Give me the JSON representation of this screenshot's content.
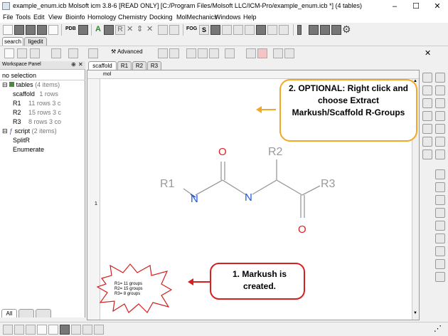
{
  "window": {
    "title": "example_enum.icb Molsoft icm 3.8-6 [READ ONLY]  [C:/Program Files/Molsoft LLC/ICM-Pro/example_enum.icb *] (4 tables)",
    "minimize": "–",
    "maximize": "☐",
    "close": "✕"
  },
  "menu": [
    "File",
    "Tools",
    "Edit",
    "View",
    "Bioinfo",
    "Homology",
    "Chemistry",
    "Docking",
    "MolMechanics",
    "Windows",
    "Help"
  ],
  "toolbar": {
    "pdb_label": "PDB",
    "fog_label": "FOG",
    "advanced_label": "Advanced"
  },
  "subtabs": [
    "search",
    "ligedit"
  ],
  "panel": {
    "title": "Workspace Panel",
    "selection": "no selection",
    "tables": {
      "name": "tables",
      "count": "(4 items)"
    },
    "rows": [
      {
        "name": "scaffold",
        "info": "1 rows"
      },
      {
        "name": "R1",
        "info": "11 rows 3 c"
      },
      {
        "name": "R2",
        "info": "15 rows 3 c"
      },
      {
        "name": "R3",
        "info": "8 rows 3 co"
      }
    ],
    "script": {
      "name": "script",
      "count": "(2 items)"
    },
    "scripts": [
      "SplitR",
      "Enumerate"
    ],
    "bottom_tabs": [
      "All"
    ]
  },
  "doc": {
    "tabs": [
      "scaffold",
      "R1",
      "R2",
      "R3"
    ],
    "header": "mol",
    "row_number": "1"
  },
  "molecule": {
    "atoms": {
      "r1": "R1",
      "r2": "R2",
      "r3": "R3",
      "n1": "N",
      "n2": "N",
      "o1": "O",
      "o2": "O"
    }
  },
  "callouts": {
    "optional": "2. OPTIONAL: Right click and choose Extract Markush/Scaffold R-Groups",
    "markush": "1. Markush is created."
  },
  "burst": {
    "lines": [
      "R1= 11 groups",
      "R2= 15 groups",
      "R3= 8 groups"
    ]
  },
  "colors": {
    "callout_orange": "#f5a623",
    "callout_red": "#d62020",
    "nitrogen": "#1a56d6",
    "oxygen": "#e02020",
    "grey_bond": "#999999"
  }
}
